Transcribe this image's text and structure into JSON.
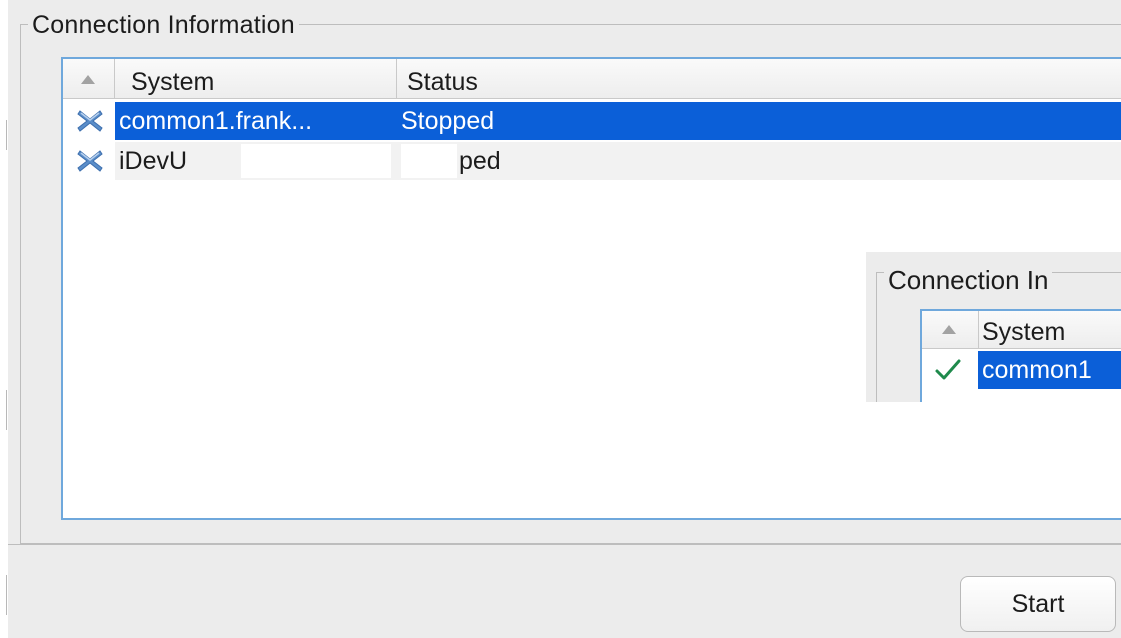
{
  "connection_panel": {
    "title": "Connection Information",
    "columns": {
      "system": "System",
      "status": "Status"
    },
    "rows": [
      {
        "system": "common1.frank...",
        "status": "Stopped",
        "icon": "x-mark-icon",
        "selected": true
      },
      {
        "system": "iDevU",
        "status": "ped",
        "icon": "x-mark-icon",
        "selected": false
      }
    ]
  },
  "inset_panel": {
    "title": "Connection In",
    "columns": {
      "system": "System"
    },
    "rows": [
      {
        "system": "common1",
        "icon": "checkmark-icon",
        "selected": true
      }
    ]
  },
  "actions": {
    "start_label": "Start"
  },
  "colors": {
    "selection": "#0b5fd8",
    "focus_border": "#6fa8dc",
    "window_bg": "#ececec",
    "x_icon": "#5b8ec9",
    "check_icon": "#1f8a4c"
  }
}
